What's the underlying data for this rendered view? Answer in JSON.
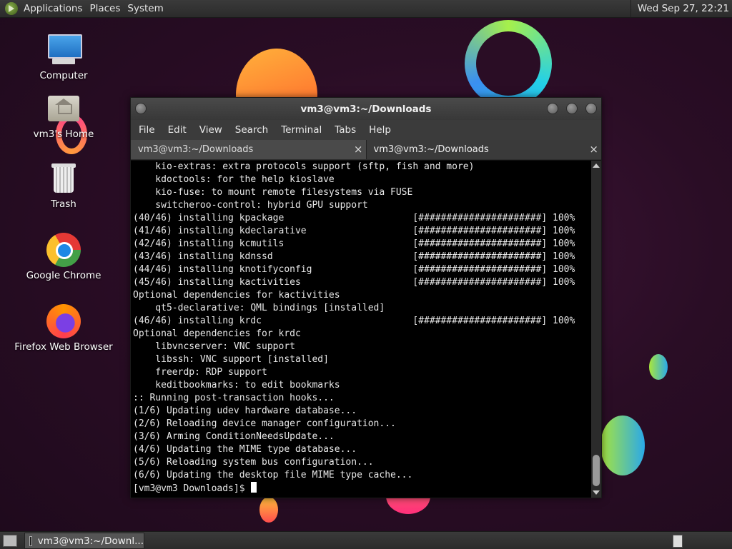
{
  "top_panel": {
    "menus": [
      "Applications",
      "Places",
      "System"
    ],
    "clock": "Wed Sep 27, 22:21"
  },
  "desktop_icons": [
    {
      "label": "Computer",
      "icon": "computer-icon"
    },
    {
      "label": "vm3's Home",
      "icon": "home-folder-icon"
    },
    {
      "label": "Trash",
      "icon": "trash-icon"
    },
    {
      "label": "Google Chrome",
      "icon": "chrome-icon"
    },
    {
      "label": "Firefox Web Browser",
      "icon": "firefox-icon"
    }
  ],
  "window": {
    "title": "vm3@vm3:~/Downloads",
    "menu": [
      "File",
      "Edit",
      "View",
      "Search",
      "Terminal",
      "Tabs",
      "Help"
    ],
    "tabs": [
      {
        "label": "vm3@vm3:~/Downloads",
        "active": false
      },
      {
        "label": "vm3@vm3:~/Downloads",
        "active": true
      }
    ],
    "tab_close": "×",
    "terminal_lines": [
      "    kio-extras: extra protocols support (sftp, fish and more)",
      "    kdoctools: for the help kioslave",
      "    kio-fuse: to mount remote filesystems via FUSE",
      "    switcheroo-control: hybrid GPU support",
      "(40/46) installing kpackage                       [######################] 100%",
      "(41/46) installing kdeclarative                   [######################] 100%",
      "(42/46) installing kcmutils                       [######################] 100%",
      "(43/46) installing kdnssd                         [######################] 100%",
      "(44/46) installing knotifyconfig                  [######################] 100%",
      "(45/46) installing kactivities                    [######################] 100%",
      "Optional dependencies for kactivities",
      "    qt5-declarative: QML bindings [installed]",
      "(46/46) installing krdc                           [######################] 100%",
      "Optional dependencies for krdc",
      "    libvncserver: VNC support",
      "    libssh: VNC support [installed]",
      "    freerdp: RDP support",
      "    keditbookmarks: to edit bookmarks",
      ":: Running post-transaction hooks...",
      "(1/6) Updating udev hardware database...",
      "(2/6) Reloading device manager configuration...",
      "(3/6) Arming ConditionNeedsUpdate...",
      "(4/6) Updating the MIME type database...",
      "(5/6) Reloading system bus configuration...",
      "(6/6) Updating the desktop file MIME type cache..."
    ],
    "prompt": "[vm3@vm3 Downloads]$"
  },
  "taskbar": {
    "task_label": "vm3@vm3:~/Downl..."
  }
}
